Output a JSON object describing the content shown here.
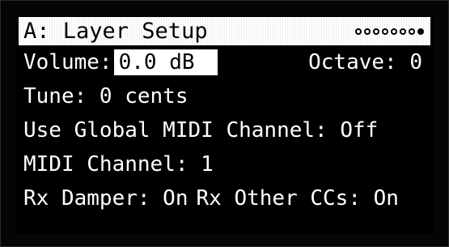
{
  "header": {
    "title": "A: Layer Setup",
    "page_count": 8,
    "active_page_index": 7
  },
  "params": {
    "volume_label": "Volume:",
    "volume_value": "0.0 dB",
    "octave": "Octave: 0",
    "tune": "Tune: 0 cents",
    "use_global_midi": "Use Global MIDI Channel: Off",
    "midi_channel": "MIDI Channel: 1",
    "rx_damper": "Rx Damper: On",
    "rx_other_ccs": "Rx Other CCs: On"
  },
  "colors": {
    "lcd_background": "#000000",
    "text": "#ffffff",
    "highlight": "#ffffff"
  }
}
